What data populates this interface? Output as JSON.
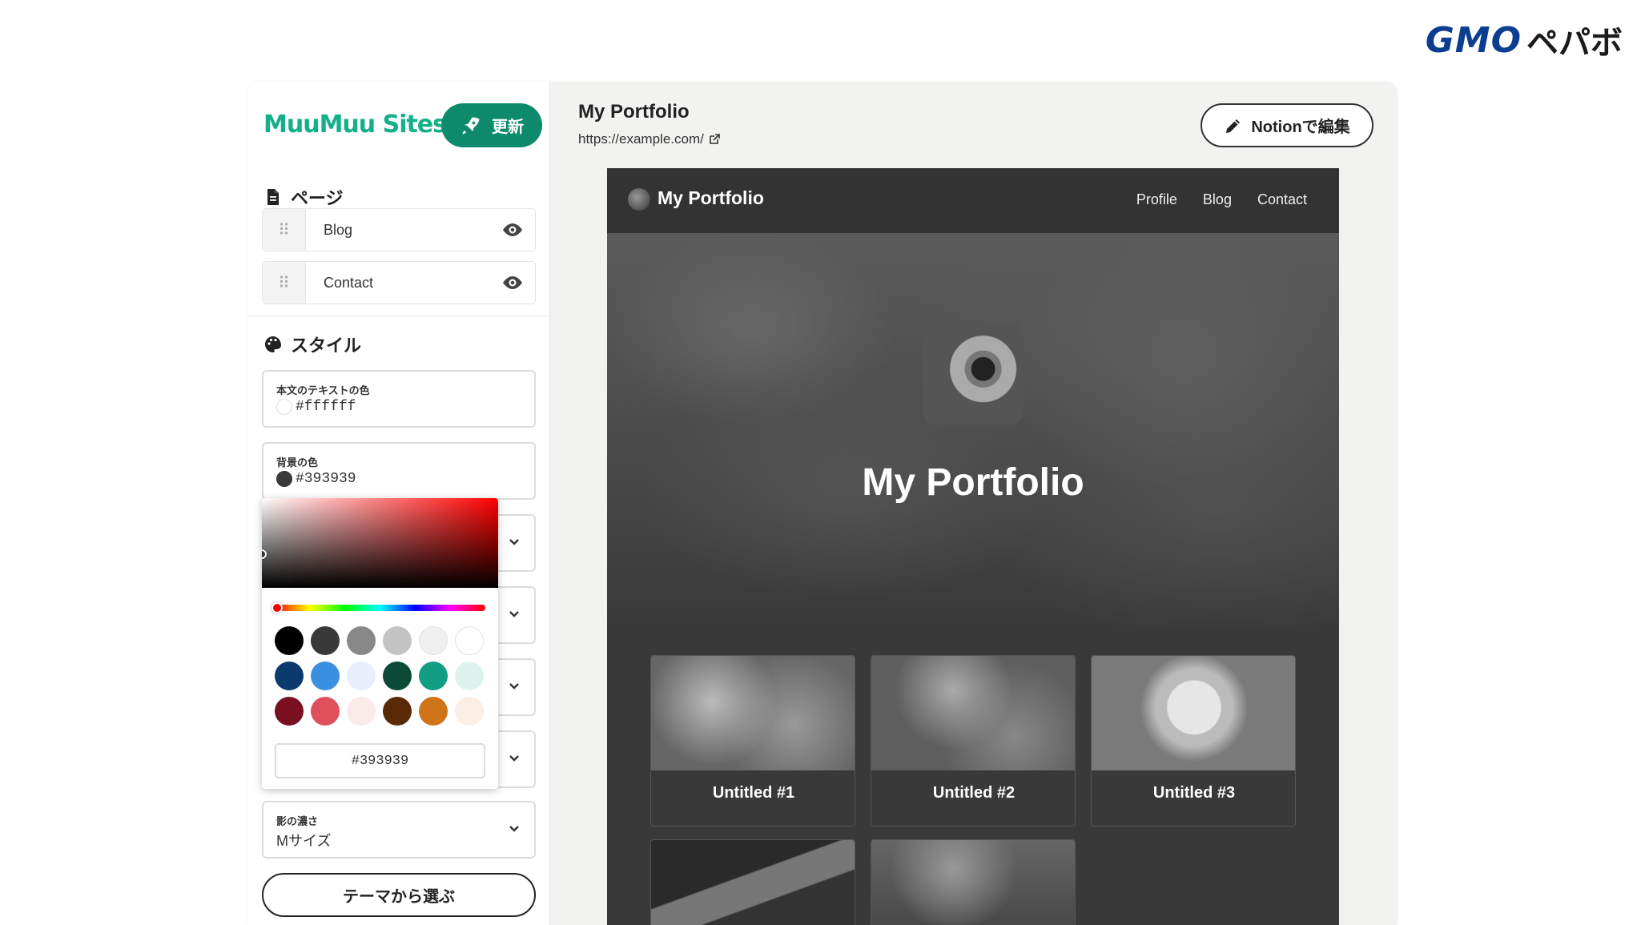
{
  "gmo_logo": {
    "mark": "GMO",
    "text": "ペパボ"
  },
  "sidebar": {
    "brand": "MuuMuu Sites",
    "update_label": "更新",
    "pages_heading": "ページ",
    "pages": [
      {
        "label": "Blog"
      },
      {
        "label": "Contact"
      }
    ],
    "style_heading": "スタイル",
    "text_color": {
      "label": "本文のテキストの色",
      "value": "#ffffff"
    },
    "bg_color": {
      "label": "背景の色",
      "value": "#393939"
    },
    "shadow": {
      "label": "影の濃さ",
      "value": "Mサイズ"
    },
    "theme_button": "テーマから選ぶ"
  },
  "picker": {
    "hex_value": "#393939",
    "swatches": [
      "#000000",
      "#393939",
      "#888888",
      "#c4c4c4",
      "#efefef",
      "#ffffff",
      "#0b3a6e",
      "#3b8fe0",
      "#e8eefb",
      "#0b4a36",
      "#119e82",
      "#dff3ee",
      "#7a0f22",
      "#e0505c",
      "#fbeaea",
      "#5a2a06",
      "#d0741a",
      "#fbeee4"
    ]
  },
  "main": {
    "title": "My Portfolio",
    "url": "https://example.com/",
    "notion_button": "Notionで編集"
  },
  "preview": {
    "brand": "My Portfolio",
    "nav": [
      "Profile",
      "Blog",
      "Contact"
    ],
    "hero_title": "My Portfolio",
    "cards": [
      "Untitled #1",
      "Untitled #2",
      "Untitled #3"
    ]
  }
}
